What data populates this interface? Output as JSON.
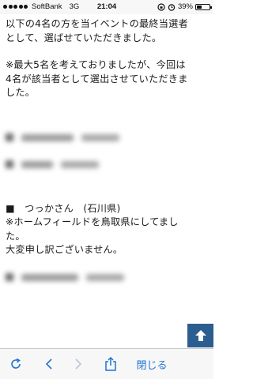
{
  "status_bar": {
    "carrier": "SoftBank",
    "network": "3G",
    "time": "21:04",
    "battery_percent": "39%",
    "battery_level": 0.39,
    "icons": [
      "signal-dots-icon",
      "rotation-lock-icon",
      "alarm-icon",
      "battery-icon"
    ]
  },
  "article": {
    "paragraph_1": [
      "以下の4名の方を当イベントの最終当選者",
      "として、選ばせていただきました。"
    ],
    "paragraph_2": [
      "※最大5名を考えておりましたが、今回は",
      "4名が該当者として選出させていただきま",
      "した。"
    ],
    "winner_entry": {
      "line_1": "■　つっかさん　(石川県)",
      "line_2": "※ホームフィールドを鳥取県にしてまし",
      "line_3": "た。",
      "line_4": "大変申し訳ございません。"
    }
  },
  "toolbar": {
    "close_label": "閉じる",
    "icons": [
      "refresh-icon",
      "back-icon",
      "forward-icon",
      "share-icon"
    ]
  },
  "colors": {
    "accent": "#1f74d6",
    "scroll_button": "#2c5d8f",
    "bar_bg": "#f7f7f7"
  }
}
